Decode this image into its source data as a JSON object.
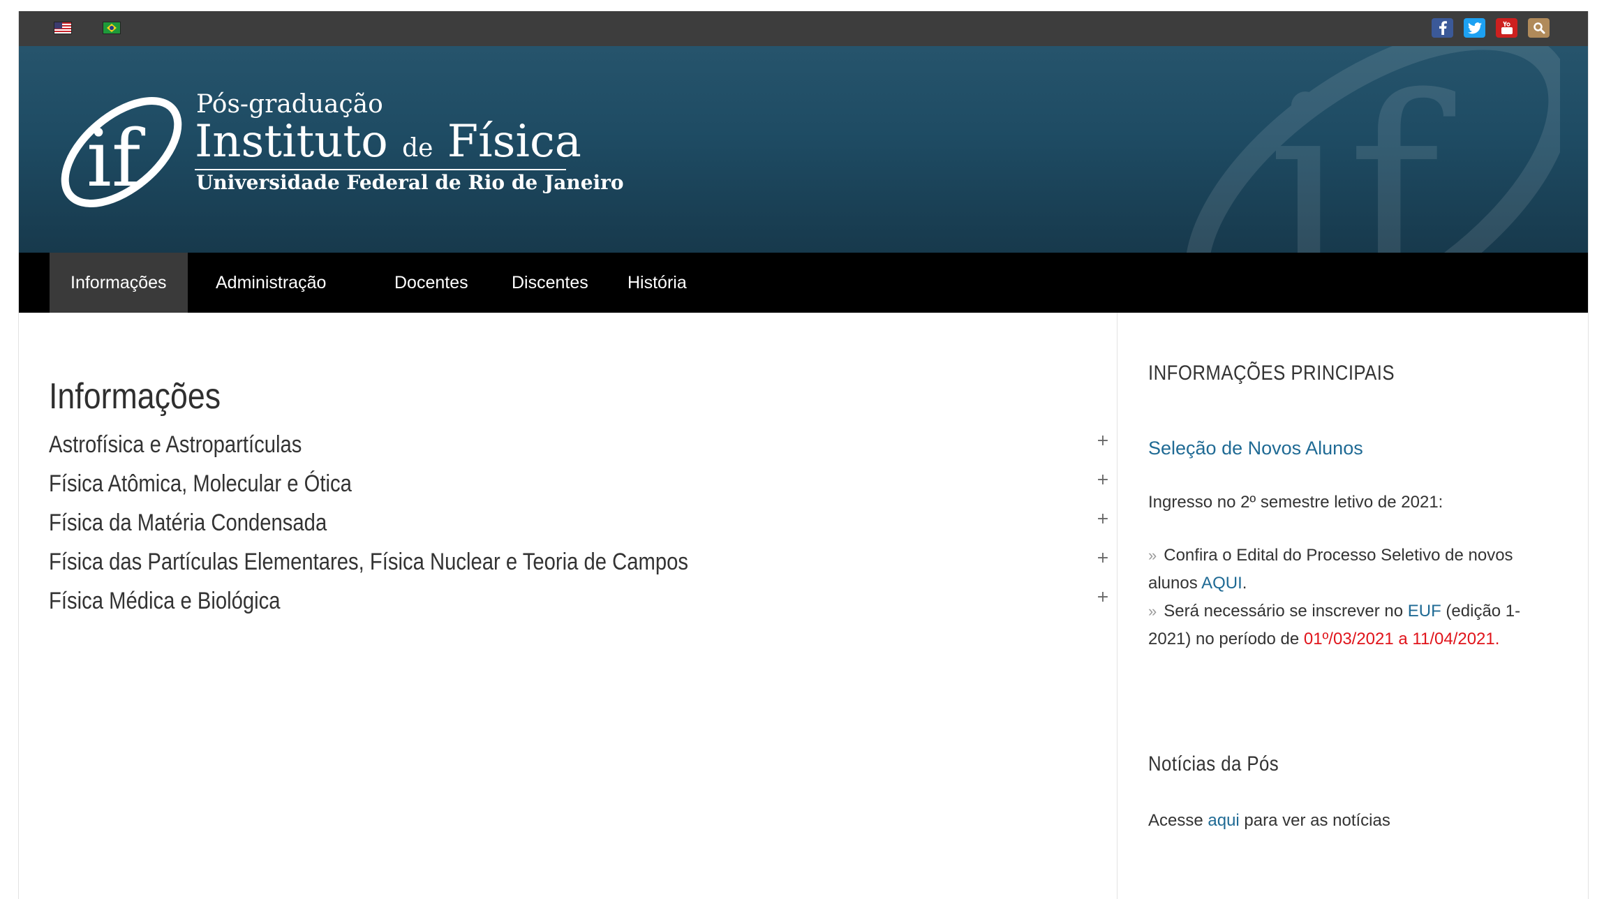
{
  "topbar": {
    "flags": [
      {
        "name": "english-flag",
        "icon": "us-flag-icon"
      },
      {
        "name": "portuguese-flag",
        "icon": "brazil-flag-icon"
      }
    ],
    "social": [
      "facebook-icon",
      "twitter-icon",
      "youtube-icon",
      "search-icon"
    ],
    "colors": {
      "facebook": "#3b5998",
      "twitter": "#1da1f2",
      "youtube": "#cd201f",
      "search": "#b08a5a"
    }
  },
  "header": {
    "logo_short": "if",
    "line1": "Pós-graduação",
    "line2a": "Instituto",
    "line2b": "de",
    "line2c": "Física",
    "line3": "Universidade Federal de Rio de Janeiro"
  },
  "nav": {
    "items": [
      {
        "label": "Informações",
        "active": true
      },
      {
        "label": "Administração"
      },
      {
        "label": "Docentes"
      },
      {
        "label": "Discentes"
      },
      {
        "label": "História"
      }
    ]
  },
  "main": {
    "title": "Informações",
    "accordion": [
      {
        "label": "Astrofísica e Astropartículas"
      },
      {
        "label": "Física Atômica, Molecular e Ótica"
      },
      {
        "label": "Física da Matéria Condensada"
      },
      {
        "label": "Física das Partículas Elementares, Física Nuclear e Teoria de Campos"
      },
      {
        "label": "Física Médica e Biológica"
      }
    ],
    "plus_symbol": "+"
  },
  "sidebar": {
    "widget1_title": "INFORMAÇÕES PRINCIPAIS",
    "selecao_link": "Seleção de Novos Alunos",
    "ingresso": "Ingresso no 2º semestre letivo de 2021:",
    "bullet1_pre": "Confira o Edital do Processo Seletivo de novos alunos ",
    "bullet1_link": "AQUI",
    "bullet1_post": ".",
    "bullet2_pre": "Será necessário se inscrever no ",
    "bullet2_link": "EUF",
    "bullet2_mid": " (edição 1-2021) no período de ",
    "bullet2_red": "01º/03/2021 a 11/04/2021.",
    "widget2_title": "Notícias da Pós",
    "news_pre": "Acesse ",
    "news_link": "aqui",
    "news_post": " para ver as notícias",
    "link_color": "#1f6a94",
    "highlight_color": "#e0141b"
  }
}
